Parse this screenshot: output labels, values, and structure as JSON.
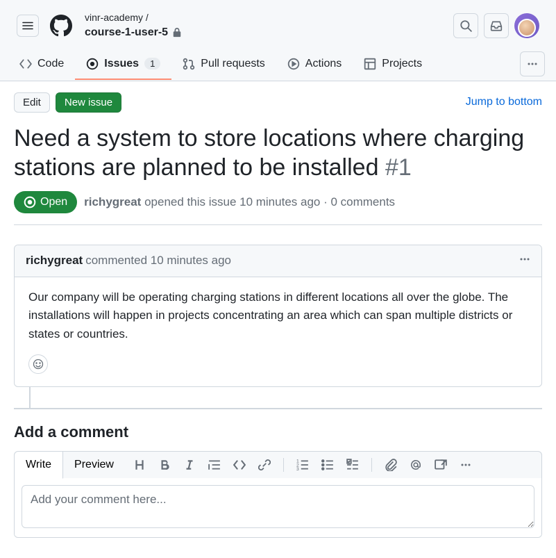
{
  "breadcrumb": {
    "org": "vinr-academy",
    "sep": "/",
    "repo": "course-1-user-5"
  },
  "tabs": {
    "code": "Code",
    "issues": "Issues",
    "issues_count": "1",
    "pulls": "Pull requests",
    "actions": "Actions",
    "projects": "Projects"
  },
  "buttons": {
    "edit": "Edit",
    "new_issue": "New issue",
    "jump": "Jump to bottom"
  },
  "issue": {
    "title": "Need a system to store locations where charging stations are planned to be installed",
    "number": "#1",
    "status": "Open",
    "author": "richygreat",
    "opened_meta": "opened this issue 10 minutes ago · 0 comments"
  },
  "comment": {
    "author": "richygreat",
    "meta": "commented 10 minutes ago",
    "body": "Our company will be operating charging stations in different locations all over the globe. The installations will happen in projects concentrating an area which can span multiple districts or states or countries."
  },
  "add_comment": {
    "heading": "Add a comment",
    "write": "Write",
    "preview": "Preview",
    "placeholder": "Add your comment here..."
  }
}
